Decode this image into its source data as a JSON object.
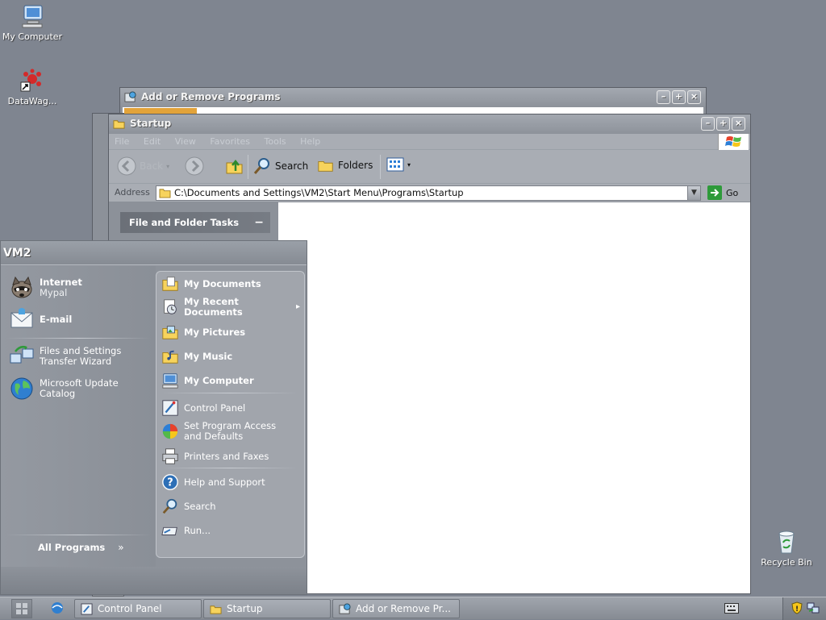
{
  "desktop": {
    "icons": [
      {
        "label": "My Computer",
        "icon": "computer-icon"
      },
      {
        "label": "DataWag...",
        "icon": "datawag-shortcut-icon"
      },
      {
        "label": "Recycle Bin",
        "icon": "recycle-bin-icon"
      }
    ]
  },
  "windows": {
    "add_remove": {
      "title": "Add or Remove Programs"
    },
    "startup": {
      "title": "Startup",
      "menu": [
        "File",
        "Edit",
        "View",
        "Favorites",
        "Tools",
        "Help"
      ],
      "toolbar": {
        "back": "Back",
        "search": "Search",
        "folders": "Folders"
      },
      "address_label": "Address",
      "address": "C:\\Documents and Settings\\VM2\\Start Menu\\Programs\\Startup",
      "go": "Go",
      "task_header": "File and Folder Tasks",
      "task_toggle": "−"
    }
  },
  "start_menu": {
    "user": "VM2",
    "pinned": [
      {
        "title": "Internet",
        "subtitle": "Mypal",
        "icon": "raccoon-browser-icon"
      },
      {
        "title": "E-mail",
        "subtitle": "",
        "icon": "email-icon"
      }
    ],
    "recent": [
      {
        "line1": "Files and Settings",
        "line2": "Transfer Wizard",
        "icon": "transfer-wizard-icon"
      },
      {
        "line1": "Microsoft Update",
        "line2": "Catalog",
        "icon": "globe-icon"
      }
    ],
    "all_programs": "All Programs",
    "right": [
      {
        "line1": "My Documents",
        "line2": "",
        "bold": true,
        "icon": "folder-documents-icon"
      },
      {
        "line1": "My Recent",
        "line2": "Documents",
        "bold": true,
        "icon": "recent-documents-icon",
        "arrow": "▸"
      },
      {
        "line1": "My Pictures",
        "line2": "",
        "bold": true,
        "icon": "folder-pictures-icon"
      },
      {
        "line1": "My Music",
        "line2": "",
        "bold": true,
        "icon": "folder-music-icon"
      },
      {
        "line1": "My Computer",
        "line2": "",
        "bold": true,
        "icon": "computer-icon"
      },
      {
        "line1": "Control Panel",
        "line2": "",
        "bold": false,
        "icon": "control-panel-icon"
      },
      {
        "line1": "Set Program Access",
        "line2": "and Defaults",
        "bold": false,
        "icon": "program-access-icon"
      },
      {
        "line1": "Printers and Faxes",
        "line2": "",
        "bold": false,
        "icon": "printer-icon"
      },
      {
        "line1": "Help and Support",
        "line2": "",
        "bold": false,
        "icon": "help-icon"
      },
      {
        "line1": "Search",
        "line2": "",
        "bold": false,
        "icon": "search-icon"
      },
      {
        "line1": "Run...",
        "line2": "",
        "bold": false,
        "icon": "run-icon"
      }
    ]
  },
  "taskbar": {
    "buttons": [
      {
        "label": "Control Panel",
        "icon": "control-panel-icon"
      },
      {
        "label": "Startup",
        "icon": "folder-icon"
      },
      {
        "label": "Add or Remove Pr...",
        "icon": "add-remove-icon"
      }
    ]
  },
  "colors": {
    "desktop": "#7f8590",
    "accent": "#8d929a"
  }
}
